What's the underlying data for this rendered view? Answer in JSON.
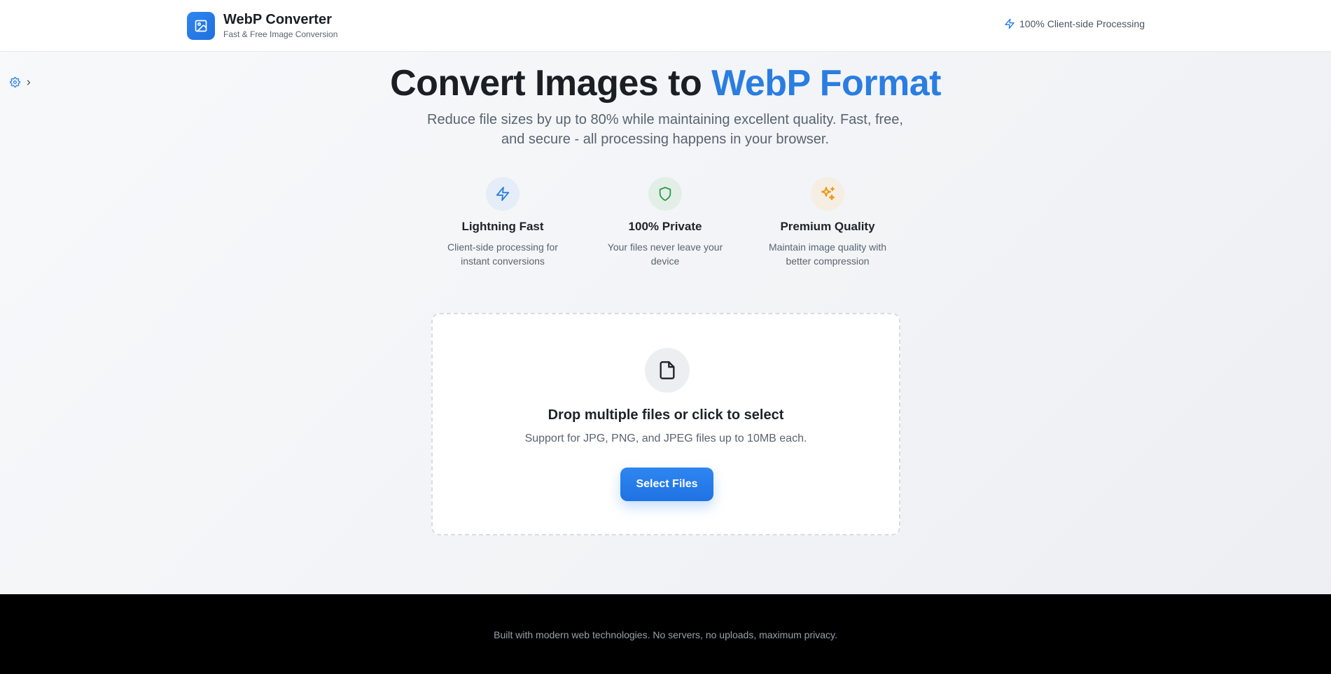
{
  "header": {
    "title": "WebP Converter",
    "subtitle": "Fast & Free Image Conversion",
    "badge": "100% Client-side Processing",
    "logo_icon": "image-icon",
    "badge_icon": "lightning-icon"
  },
  "sidebar_toggle": {
    "icons": [
      "gear-icon",
      "chevron-right-icon"
    ]
  },
  "hero": {
    "title_main": "Convert Images to ",
    "title_accent": "WebP Format",
    "subtitle_line1": "Reduce file sizes by up to 80% while maintaining excellent quality. Fast, free,",
    "subtitle_line2": "and secure - all processing happens in your browser."
  },
  "features": [
    {
      "icon": "lightning-icon",
      "title": "Lightning Fast",
      "desc_line1": "Client-side processing for",
      "desc_line2": "instant conversions",
      "color": "#2a7de1",
      "bg": "#e4edf8"
    },
    {
      "icon": "shield-icon",
      "title": "100% Private",
      "desc_line1": "Your files never leave your",
      "desc_line2": "device",
      "color": "#2e9a4e",
      "bg": "#e3efe6"
    },
    {
      "icon": "sparkles-icon",
      "title": "Premium Quality",
      "desc_line1": "Maintain image quality with",
      "desc_line2": "better compression",
      "color": "#ea9a1c",
      "bg": "#f6eee2"
    }
  ],
  "dropzone": {
    "icon": "file-icon",
    "title": "Drop multiple files or click to select",
    "subtitle": "Support for JPG, PNG, and JPEG files up to 10MB each.",
    "button_label": "Select Files"
  },
  "footer": {
    "text": "Built with modern web technologies. No servers, no uploads, maximum privacy."
  },
  "colors": {
    "accent": "#2a7de1",
    "footer_bg": "#000000"
  }
}
